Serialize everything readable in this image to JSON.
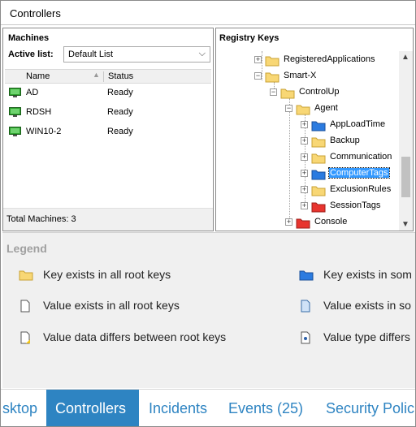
{
  "window": {
    "title": "Controllers"
  },
  "machines": {
    "heading": "Machines",
    "active_list_label": "Active list:",
    "active_list_value": "Default List",
    "columns": {
      "name": "Name",
      "status": "Status"
    },
    "rows": [
      {
        "name": "AD",
        "status": "Ready"
      },
      {
        "name": "RDSH",
        "status": "Ready"
      },
      {
        "name": "WIN10-2",
        "status": "Ready"
      }
    ],
    "total": "Total Machines: 3"
  },
  "registry": {
    "heading": "Registry Keys",
    "nodes": [
      {
        "label": "RegisteredApplications",
        "color": "yellow",
        "expander": "+"
      },
      {
        "label": "Smart-X",
        "color": "yellow",
        "expander": "−"
      },
      {
        "label": "ControlUp",
        "color": "yellow",
        "expander": "−"
      },
      {
        "label": "Agent",
        "color": "yellow",
        "expander": "−"
      },
      {
        "label": "AppLoadTime",
        "color": "blue",
        "expander": "+"
      },
      {
        "label": "Backup",
        "color": "yellow",
        "expander": "+"
      },
      {
        "label": "Communication",
        "color": "yellow",
        "expander": "+"
      },
      {
        "label": "ComputerTags",
        "color": "blue",
        "expander": "+",
        "selected": true
      },
      {
        "label": "ExclusionRules",
        "color": "yellow",
        "expander": "+"
      },
      {
        "label": "SessionTags",
        "color": "red",
        "expander": "+"
      },
      {
        "label": "Console",
        "color": "red",
        "expander": "+"
      }
    ]
  },
  "legend": {
    "title": "Legend",
    "items": [
      {
        "text": "Key exists in all root keys",
        "icon": "folder-yellow-icon"
      },
      {
        "text": "Key exists in som",
        "icon": "folder-blue-icon"
      },
      {
        "text": "Value exists in all root keys",
        "icon": "value-white-icon"
      },
      {
        "text": "Value exists in so",
        "icon": "value-blue-icon"
      },
      {
        "text": "Value data differs between root keys",
        "icon": "value-data-differs-icon"
      },
      {
        "text": "Value type differs",
        "icon": "value-type-differs-icon"
      }
    ]
  },
  "tabs": [
    {
      "label": "sktop"
    },
    {
      "label": "Controllers",
      "active": true
    },
    {
      "label": "Incidents"
    },
    {
      "label": "Events (25)"
    },
    {
      "label": "Security Polic"
    }
  ],
  "colors": {
    "accent": "#2e84c2",
    "folder_yellow": "#f8d775",
    "folder_blue": "#2b7be0",
    "folder_red": "#e8342e",
    "selection": "#3399ff"
  }
}
